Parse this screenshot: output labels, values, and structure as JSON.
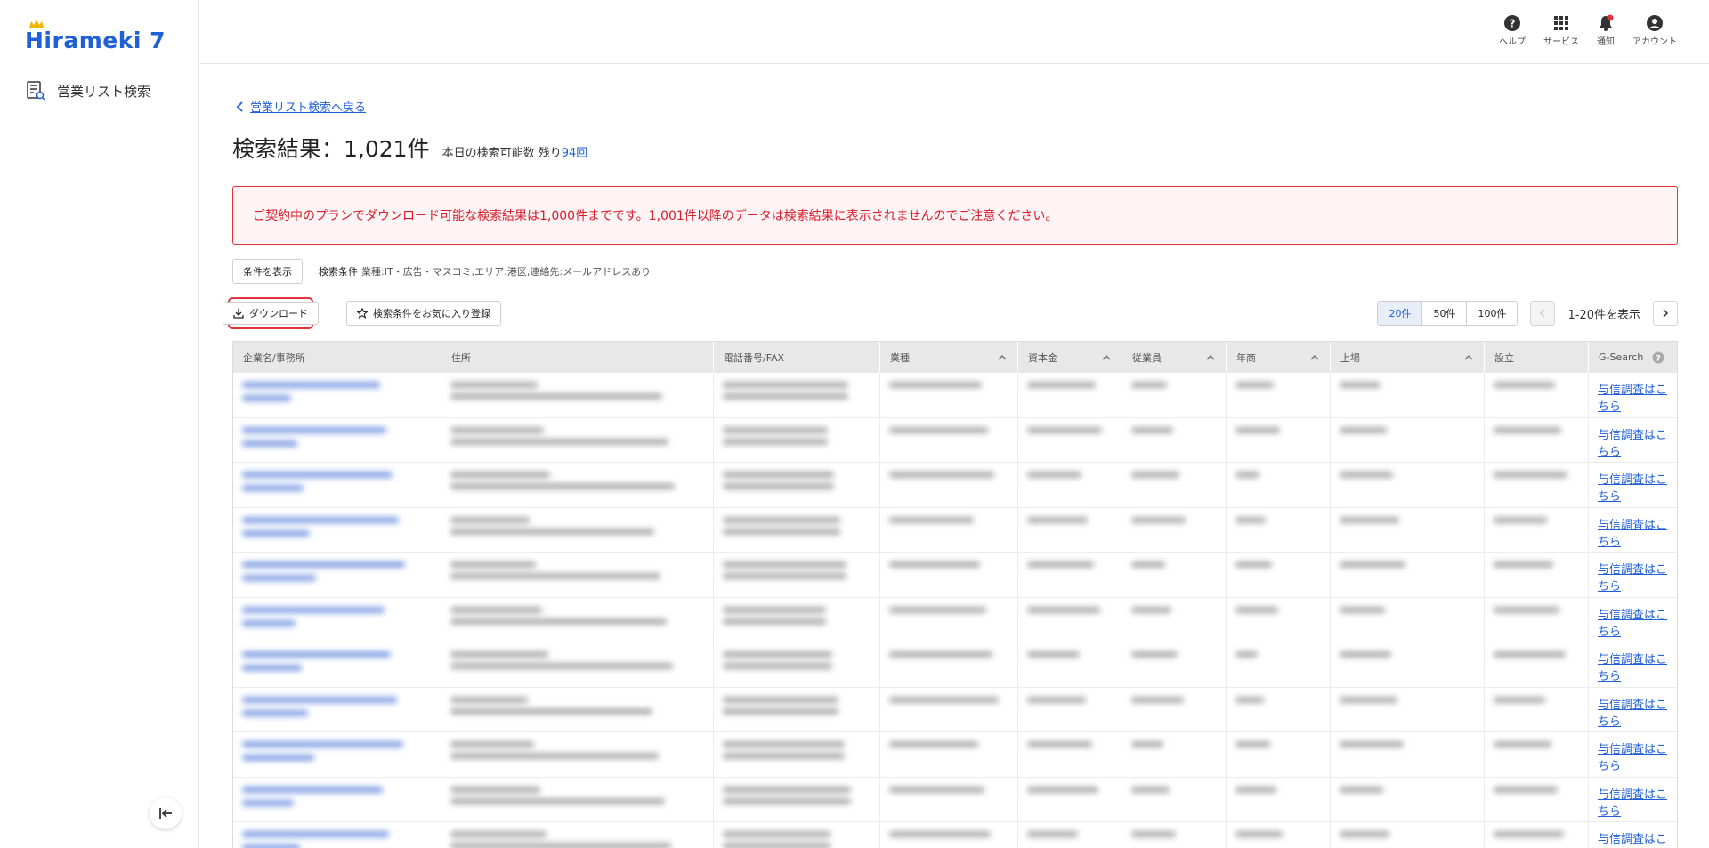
{
  "app": {
    "logo_text": "Hirameki 7"
  },
  "sidebar": {
    "items": [
      {
        "label": "営業リスト検索"
      }
    ]
  },
  "header": {
    "icons": [
      {
        "label": "ヘルプ",
        "icon": "help-icon"
      },
      {
        "label": "サービス",
        "icon": "grid-icon"
      },
      {
        "label": "通知",
        "icon": "bell-icon"
      },
      {
        "label": "アカウント",
        "icon": "account-icon"
      }
    ]
  },
  "main": {
    "back_link": "営業リスト検索へ戻る",
    "title": "検索結果：1,021件",
    "remaining_label": "本日の検索可能数 残り",
    "remaining_value": "94回",
    "alert": "ご契約中のプランでダウンロード可能な検索結果は1,000件までです。1,001件以降のデータは検索結果に表示されませんのでご注意ください。",
    "show_conditions_button": "条件を表示",
    "conditions_label": "検索条件",
    "conditions_value": "業種:IT・広告・マスコミ,エリア:港区,連絡先:メールアドレスあり",
    "download_button": "ダウンロード",
    "favorite_button": "検索条件をお気に入り登録",
    "page_sizes": [
      "20件",
      "50件",
      "100件"
    ],
    "page_size_selected": "20件",
    "range_text": "1-20件を表示"
  },
  "table": {
    "headers": [
      "企業名/事務所",
      "住所",
      "電話番号/FAX",
      "業種",
      "資本金",
      "従業員",
      "年商",
      "上場",
      "設立",
      "G-Search"
    ],
    "gsearch_link": "与信調査はこちら",
    "visible_rows": 11
  },
  "colors": {
    "accent": "#1f5fd8",
    "alert_red": "#d91c2a",
    "alert_bg": "#fff4f5"
  }
}
